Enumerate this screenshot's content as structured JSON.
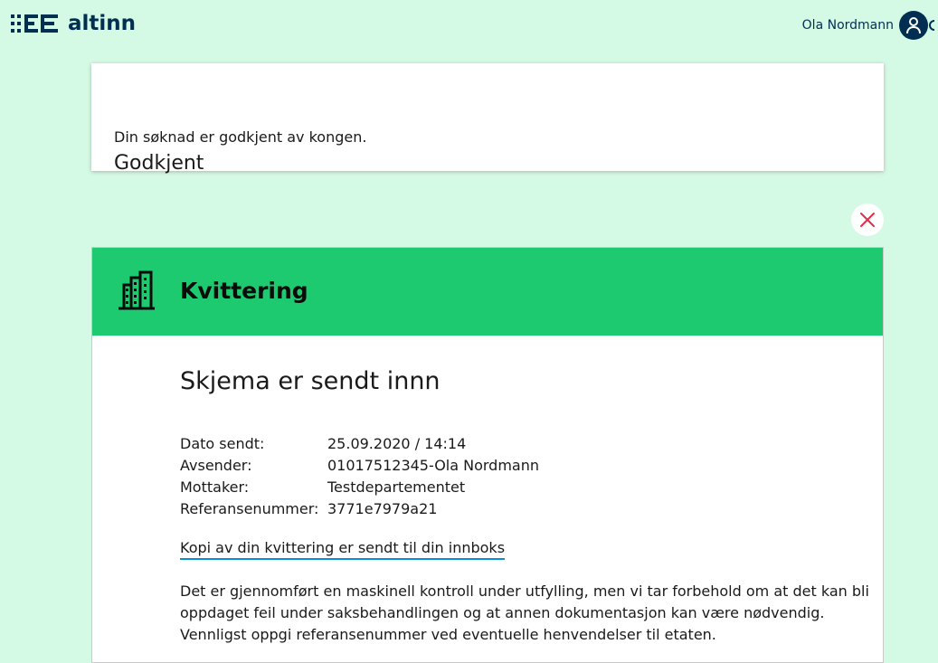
{
  "header": {
    "logo_text": "altinn",
    "user_name": "Ola Nordmann",
    "logo_icon": "altinn-logo-mark",
    "avatar_icon": "person-icon"
  },
  "status_card": {
    "title": "Godkjent",
    "message": "Din søknad er godkjent av kongen."
  },
  "close_button": {
    "icon": "close-icon",
    "color": "#e02e49"
  },
  "receipt": {
    "heading": "Kvittering",
    "header_icon": "building-icon",
    "header_color": "#1eca6f",
    "title": "Skjema er sendt innn",
    "details": [
      {
        "label": "Dato sendt:",
        "value": "25.09.2020 / 14:14"
      },
      {
        "label": "Avsender:",
        "value": "01017512345-Ola Nordmann"
      },
      {
        "label": "Mottaker:",
        "value": "Testdepartementet"
      },
      {
        "label": "Referansenummer:",
        "value": "3771e7979a21"
      }
    ],
    "copy_link": "Kopi av din kvittering er sendt til din innboks",
    "disclaimer_lines": [
      "Det er gjennomført en maskinell kontroll under utfylling, men vi tar forbehold om at det kan bli",
      "oppdaget feil under saksbehandlingen og at annen dokumentasjon kan være nødvendig.",
      "Vennligst oppgi referansenummer ved eventuelle henvendelser til etaten."
    ]
  }
}
